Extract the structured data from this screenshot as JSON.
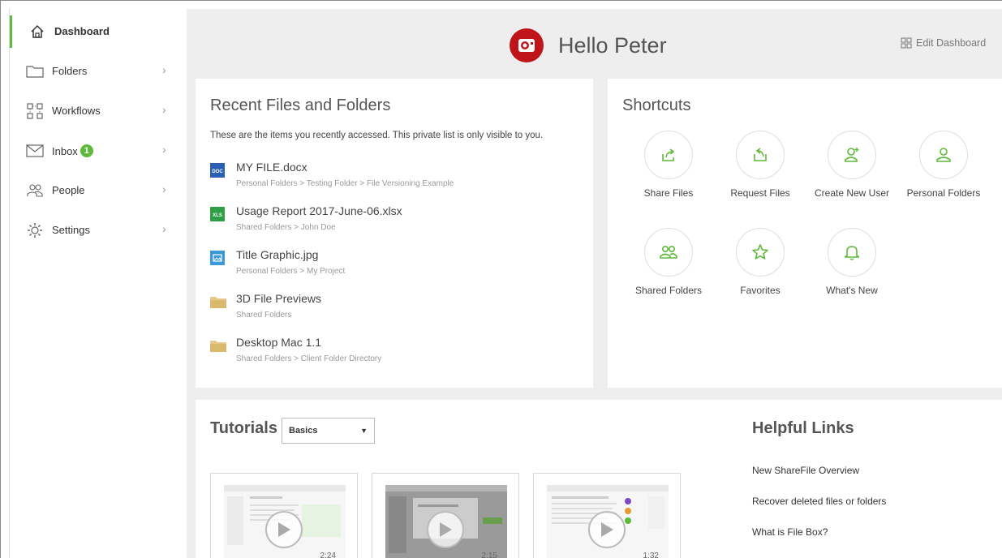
{
  "sidebar": {
    "items": [
      {
        "label": "Dashboard",
        "icon": "home-icon"
      },
      {
        "label": "Folders",
        "icon": "folder-icon"
      },
      {
        "label": "Workflows",
        "icon": "workflows-icon"
      },
      {
        "label": "Inbox",
        "icon": "inbox-icon",
        "badge": "1"
      },
      {
        "label": "People",
        "icon": "people-icon"
      },
      {
        "label": "Settings",
        "icon": "gear-icon"
      }
    ]
  },
  "header": {
    "greeting": "Hello Peter",
    "edit_dashboard": "Edit Dashboard"
  },
  "recent": {
    "title": "Recent Files and Folders",
    "description": "These are the items you recently accessed. This private list is only visible to you.",
    "items": [
      {
        "name": "MY FILE.docx",
        "path": "Personal Folders > Testing Folder > File Versioning Example",
        "type": "doc",
        "type_label": "DOC"
      },
      {
        "name": "Usage Report 2017-June-06.xlsx",
        "path": "Shared Folders > John Doe",
        "type": "xls",
        "type_label": "XLS"
      },
      {
        "name": "Title Graphic.jpg",
        "path": "Personal Folders > My Project",
        "type": "image"
      },
      {
        "name": "3D File Previews",
        "path": "Shared Folders",
        "type": "folder"
      },
      {
        "name": "Desktop Mac 1.1",
        "path": "Shared Folders > Client Folder Directory",
        "type": "folder"
      }
    ]
  },
  "shortcuts": {
    "title": "Shortcuts",
    "items": [
      {
        "label": "Share Files",
        "icon": "share-files-icon"
      },
      {
        "label": "Request Files",
        "icon": "request-files-icon"
      },
      {
        "label": "Create New User",
        "icon": "add-user-icon"
      },
      {
        "label": "Personal Folders",
        "icon": "person-icon"
      },
      {
        "label": "Shared Folders",
        "icon": "shared-people-icon"
      },
      {
        "label": "Favorites",
        "icon": "star-icon"
      },
      {
        "label": "What's New",
        "icon": "bell-icon"
      }
    ]
  },
  "tutorials": {
    "title": "Tutorials",
    "selected": "Basics",
    "videos": [
      {
        "duration": "2:24"
      },
      {
        "duration": "2:15"
      },
      {
        "duration": "1:32"
      }
    ]
  },
  "helpful_links": {
    "title": "Helpful Links",
    "links": [
      "New ShareFile Overview",
      "Recover deleted files or folders",
      "What is File Box?"
    ]
  },
  "colors": {
    "accent": "#5fb93a",
    "avatar": "#c0141b"
  }
}
